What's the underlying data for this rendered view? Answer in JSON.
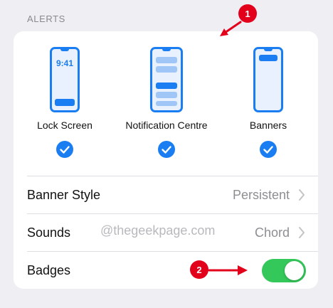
{
  "section_header": "ALERTS",
  "alert_options": [
    {
      "label": "Lock Screen",
      "checked": true,
      "icon": "lock-screen-preview",
      "preview_time": "9:41"
    },
    {
      "label": "Notification Centre",
      "checked": true,
      "icon": "notification-centre-preview"
    },
    {
      "label": "Banners",
      "checked": true,
      "icon": "banners-preview"
    }
  ],
  "rows": {
    "banner_style": {
      "label": "Banner Style",
      "value": "Persistent"
    },
    "sounds": {
      "label": "Sounds",
      "value": "Chord"
    },
    "badges": {
      "label": "Badges",
      "enabled": true
    }
  },
  "watermark": "@thegeekpage.com",
  "annotations": [
    "1",
    "2"
  ],
  "colors": {
    "accent": "#1a7ef2",
    "toggle_on": "#34c759",
    "annotation": "#e3001b",
    "background": "#efeef3"
  }
}
